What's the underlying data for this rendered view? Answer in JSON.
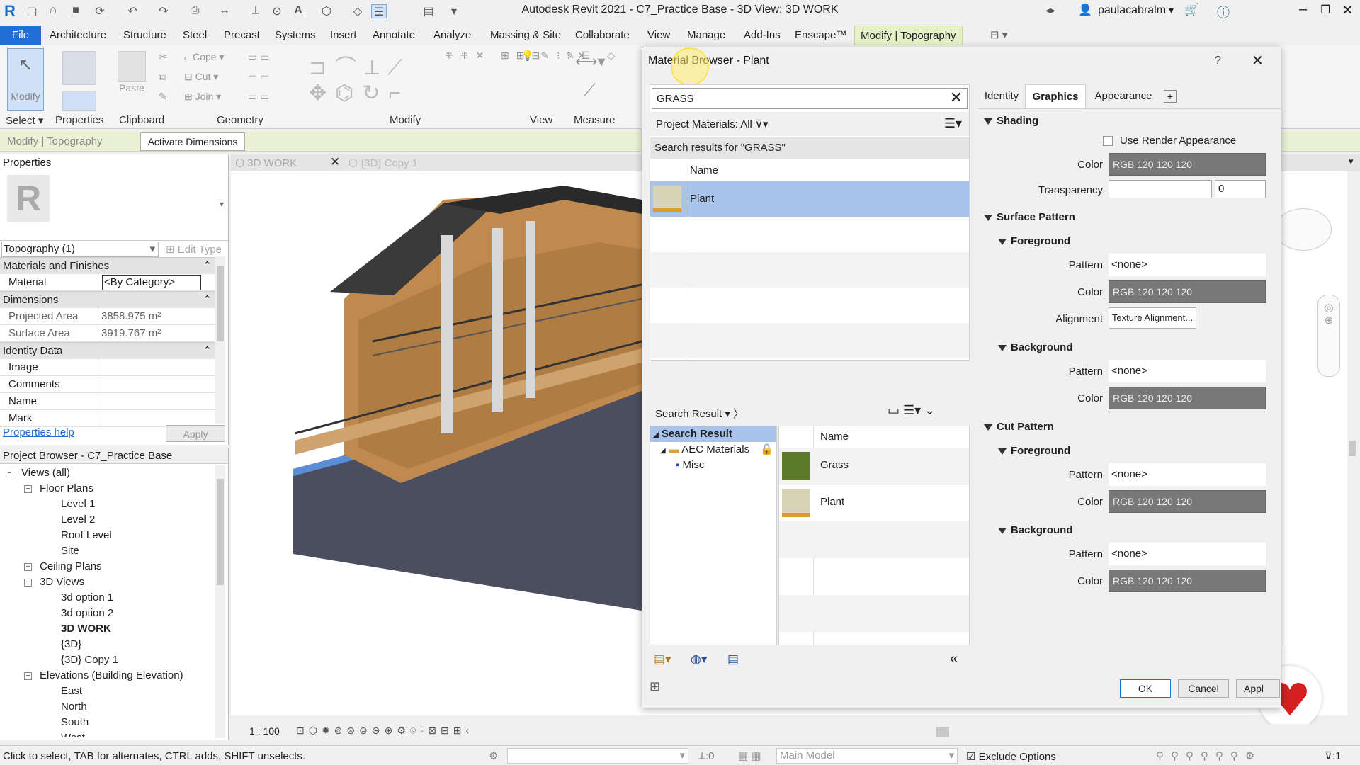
{
  "app": {
    "title": "Autodesk Revit 2021 - C7_Practice Base - 3D View: 3D WORK",
    "user": "paulacabralm",
    "logo": "R"
  },
  "ribbon_tabs": [
    "File",
    "Architecture",
    "Structure",
    "Steel",
    "Precast",
    "Systems",
    "Insert",
    "Annotate",
    "Analyze",
    "Massing & Site",
    "Collaborate",
    "View",
    "Manage",
    "Add-Ins",
    "Enscape™",
    "Modify | Topography"
  ],
  "ribbon": {
    "groups": [
      "Select ▾",
      "Properties",
      "Clipboard",
      "Geometry",
      "Modify",
      "View",
      "Measure"
    ],
    "modify_label": "Modify",
    "paste_label": "Paste",
    "cope": "Cope",
    "cut": "Cut",
    "join": "Join"
  },
  "context_bar": {
    "label": "Modify | Topography",
    "button": "Activate Dimensions"
  },
  "properties": {
    "header": "Properties",
    "type_selector": "Topography (1)",
    "edit_type": "Edit Type",
    "sections": [
      {
        "name": "Materials and Finishes",
        "rows": [
          {
            "k": "Material",
            "v": "<By Category>"
          }
        ]
      },
      {
        "name": "Dimensions",
        "rows": [
          {
            "k": "Projected Area",
            "v": "3858.975 m²"
          },
          {
            "k": "Surface Area",
            "v": "3919.767 m²"
          }
        ]
      },
      {
        "name": "Identity Data",
        "rows": [
          {
            "k": "Image",
            "v": ""
          },
          {
            "k": "Comments",
            "v": ""
          },
          {
            "k": "Name",
            "v": ""
          },
          {
            "k": "Mark",
            "v": ""
          }
        ]
      }
    ],
    "help_link": "Properties help",
    "apply": "Apply"
  },
  "browser": {
    "header": "Project Browser - C7_Practice Base",
    "items": [
      {
        "label": "Views (all)",
        "level": 0,
        "box": "−"
      },
      {
        "label": "Floor Plans",
        "level": 1,
        "box": "−"
      },
      {
        "label": "Level 1",
        "level": 2
      },
      {
        "label": "Level 2",
        "level": 2
      },
      {
        "label": "Roof Level",
        "level": 2
      },
      {
        "label": "Site",
        "level": 2
      },
      {
        "label": "Ceiling Plans",
        "level": 1,
        "box": "+"
      },
      {
        "label": "3D Views",
        "level": 1,
        "box": "−"
      },
      {
        "label": "3d option 1",
        "level": 2
      },
      {
        "label": "3d option 2",
        "level": 2
      },
      {
        "label": "3D WORK",
        "level": 2,
        "bold": true
      },
      {
        "label": "{3D}",
        "level": 2
      },
      {
        "label": "{3D} Copy 1",
        "level": 2
      },
      {
        "label": "Elevations (Building Elevation)",
        "level": 1,
        "box": "−"
      },
      {
        "label": "East",
        "level": 2
      },
      {
        "label": "North",
        "level": 2
      },
      {
        "label": "South",
        "level": 2
      },
      {
        "label": "West",
        "level": 2
      }
    ]
  },
  "view_tabs": [
    "3D WORK",
    "{3D} Copy 1"
  ],
  "view_bar": {
    "scale": "1 : 100"
  },
  "status": {
    "hint": "Click to select, TAB for alternates, CTRL adds, SHIFT unselects.",
    "count": ":0",
    "model": "Main Model",
    "exclude": "Exclude Options",
    "filter": ":1"
  },
  "material_browser": {
    "title": "Material Browser - Plant",
    "search_value": "GRASS",
    "filter_label": "Project Materials: All",
    "results_caption": "Search results for \"GRASS\"",
    "name_header": "Name",
    "project_results": [
      {
        "name": "Plant",
        "selected": true,
        "swatch": "#d8d4b8"
      }
    ],
    "library_toolbar": "Search Result",
    "library_tree": [
      {
        "label": "Search Result",
        "level": 0,
        "selected": true
      },
      {
        "label": "AEC Materials",
        "level": 1
      },
      {
        "label": "Misc",
        "level": 2
      }
    ],
    "library_results": [
      {
        "name": "Grass",
        "swatch": "#5c7a2a"
      },
      {
        "name": "Plant",
        "swatch": "#d8d4b8"
      }
    ],
    "tabs": [
      "Identity",
      "Graphics",
      "Appearance"
    ],
    "active_tab": "Graphics",
    "shading": {
      "header": "Shading",
      "use_render": "Use Render Appearance",
      "color_label": "Color",
      "color": "RGB 120 120 120",
      "transparency_label": "Transparency",
      "transparency": "0"
    },
    "surface": {
      "header": "Surface Pattern",
      "fg_header": "Foreground",
      "pattern_label": "Pattern",
      "fg_pattern": "<none>",
      "color_label": "Color",
      "fg_color": "RGB 120 120 120",
      "alignment_label": "Alignment",
      "alignment_btn": "Texture Alignment...",
      "bg_header": "Background",
      "bg_pattern": "<none>",
      "bg_color": "RGB 120 120 120"
    },
    "cut": {
      "header": "Cut Pattern",
      "fg_header": "Foreground",
      "fg_pattern": "<none>",
      "fg_color": "RGB 120 120 120",
      "bg_header": "Background",
      "bg_pattern": "<none>",
      "bg_color": "RGB 120 120 120"
    },
    "buttons": {
      "ok": "OK",
      "cancel": "Cancel",
      "apply": "Appl"
    }
  },
  "colors": {
    "accent": "#1f6fd6",
    "selection": "#a9c4ea",
    "context": "#e6f0c9"
  }
}
